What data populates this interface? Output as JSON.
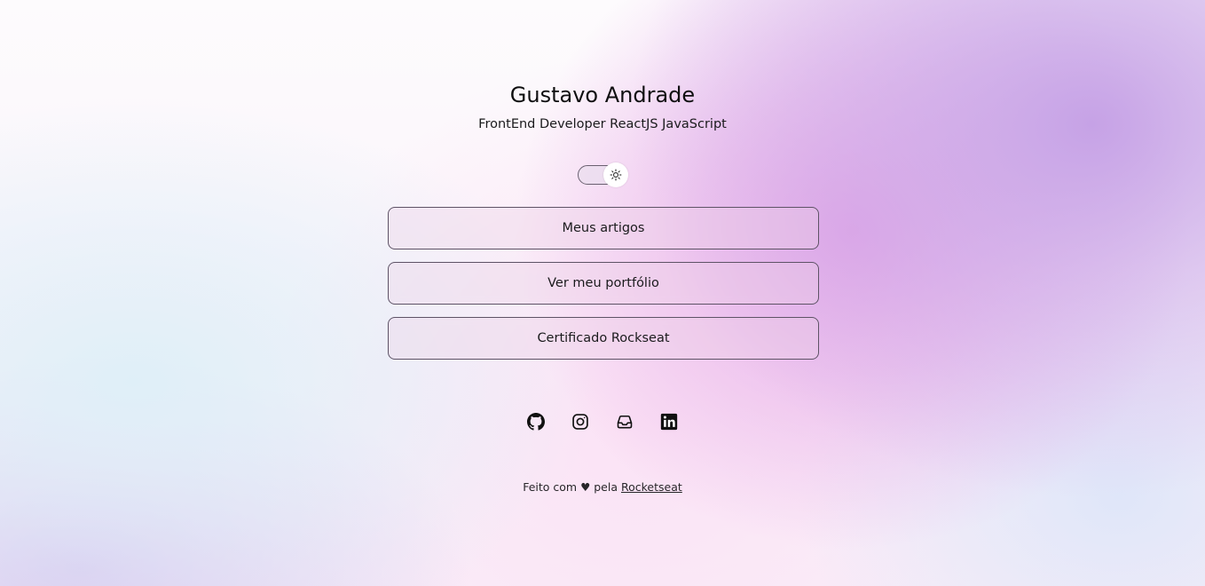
{
  "profile": {
    "name": "Gustavo Andrade",
    "subtitle": "FrontEnd Developer ReactJS JavaScript"
  },
  "theme_switch": {
    "icon": "sun-icon",
    "state": "light"
  },
  "links": [
    {
      "label": "Meus artigos"
    },
    {
      "label": "Ver meu portfólio"
    },
    {
      "label": "Certificado Rockseat"
    }
  ],
  "socials": [
    {
      "icon": "github-icon"
    },
    {
      "icon": "instagram-icon"
    },
    {
      "icon": "inbox-icon"
    },
    {
      "icon": "linkedin-icon"
    }
  ],
  "footer": {
    "text": "Feito com ♥ pela",
    "link_label": "Rocketseat"
  },
  "colors": {
    "text": "#111111",
    "button_border": "#5e5366",
    "accent_purple": "#c6a2e6",
    "accent_pink": "#e6aae8"
  }
}
